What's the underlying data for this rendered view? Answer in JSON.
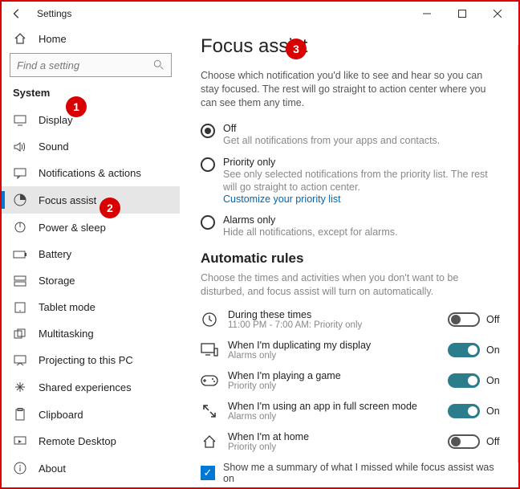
{
  "window": {
    "title": "Settings"
  },
  "sidebar": {
    "home": "Home",
    "search_placeholder": "Find a setting",
    "category": "System",
    "items": [
      {
        "label": "Display",
        "icon": "display-icon"
      },
      {
        "label": "Sound",
        "icon": "sound-icon"
      },
      {
        "label": "Notifications & actions",
        "icon": "notifications-icon"
      },
      {
        "label": "Focus assist",
        "icon": "focus-assist-icon"
      },
      {
        "label": "Power & sleep",
        "icon": "power-icon"
      },
      {
        "label": "Battery",
        "icon": "battery-icon"
      },
      {
        "label": "Storage",
        "icon": "storage-icon"
      },
      {
        "label": "Tablet mode",
        "icon": "tablet-icon"
      },
      {
        "label": "Multitasking",
        "icon": "multitasking-icon"
      },
      {
        "label": "Projecting to this PC",
        "icon": "projecting-icon"
      },
      {
        "label": "Shared experiences",
        "icon": "shared-icon"
      },
      {
        "label": "Clipboard",
        "icon": "clipboard-icon"
      },
      {
        "label": "Remote Desktop",
        "icon": "remote-icon"
      },
      {
        "label": "About",
        "icon": "about-icon"
      }
    ],
    "active_index": 3
  },
  "page": {
    "title": "Focus assist",
    "intro": "Choose which notification you'd like to see and hear so you can stay focused. The rest will go straight to action center where you can see them any time.",
    "radios": [
      {
        "title": "Off",
        "sub": "Get all notifications from your apps and contacts.",
        "selected": true
      },
      {
        "title": "Priority only",
        "sub": "See only selected notifications from the priority list. The rest will go straight to action center.",
        "link": "Customize your priority list",
        "selected": false
      },
      {
        "title": "Alarms only",
        "sub": "Hide all notifications, except for alarms.",
        "selected": false
      }
    ],
    "auto_title": "Automatic rules",
    "auto_sub": "Choose the times and activities when you don't want to be disturbed, and focus assist will turn on automatically.",
    "rules": [
      {
        "title": "During these times",
        "sub": "11:00 PM - 7:00 AM: Priority only",
        "on": false,
        "icon": "clock-icon"
      },
      {
        "title": "When I'm duplicating my display",
        "sub": "Alarms only",
        "on": true,
        "icon": "duplicate-display-icon"
      },
      {
        "title": "When I'm playing a game",
        "sub": "Priority only",
        "on": true,
        "icon": "game-icon"
      },
      {
        "title": "When I'm using an app in full screen mode",
        "sub": "Alarms only",
        "on": true,
        "icon": "fullscreen-icon"
      },
      {
        "title": "When I'm at home",
        "sub": "Priority only",
        "on": false,
        "icon": "home-location-icon"
      }
    ],
    "toggle_on_label": "On",
    "toggle_off_label": "Off",
    "summary_check": {
      "checked": true,
      "label": "Show me a summary of what I missed while focus assist was on"
    }
  },
  "callouts": {
    "c1": "1",
    "c2": "2",
    "c3": "3"
  }
}
